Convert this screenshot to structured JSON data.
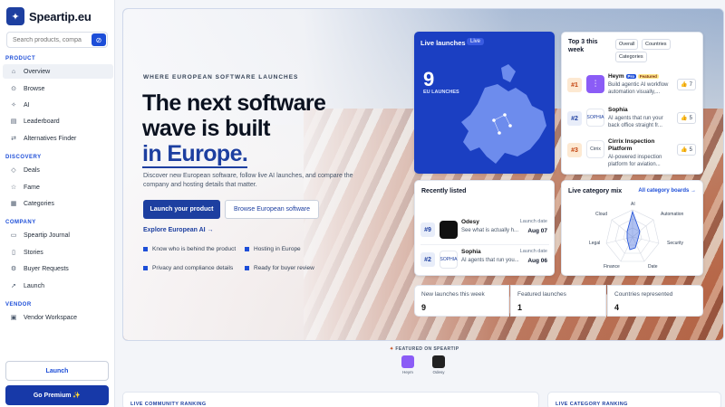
{
  "brand": {
    "name": "Speartip.eu"
  },
  "search": {
    "placeholder": "Search products, compa"
  },
  "sidebar": {
    "product_label": "PRODUCT",
    "product_items": [
      {
        "label": "Overview",
        "icon": "home-icon"
      },
      {
        "label": "Browse",
        "icon": "compass-icon"
      },
      {
        "label": "AI",
        "icon": "sparkle-icon"
      },
      {
        "label": "Leaderboard",
        "icon": "chart-icon"
      },
      {
        "label": "Alternatives Finder",
        "icon": "swap-icon"
      }
    ],
    "discovery_label": "DISCOVERY",
    "discovery_items": [
      {
        "label": "Deals",
        "icon": "tag-icon"
      },
      {
        "label": "Fame",
        "icon": "star-icon"
      },
      {
        "label": "Categories",
        "icon": "grid-icon"
      }
    ],
    "company_label": "COMPANY",
    "company_items": [
      {
        "label": "Speartip Journal",
        "icon": "book-icon"
      },
      {
        "label": "Stories",
        "icon": "doc-icon"
      },
      {
        "label": "Buyer Requests",
        "icon": "cog-icon"
      },
      {
        "label": "Launch",
        "icon": "rocket-icon"
      }
    ],
    "vendor_label": "VENDOR",
    "vendor_items": [
      {
        "label": "Vendor Workspace",
        "icon": "briefcase-icon"
      }
    ],
    "launch_button": "Launch",
    "premium_button": "Go Premium ✨"
  },
  "hero": {
    "kicker": "WHERE EUROPEAN SOFTWARE LAUNCHES",
    "title_line1": "The next software",
    "title_line2": "wave is built",
    "title_line3": "in Europe.",
    "subtitle": "Discover new European software, follow live AI launches, and compare the company and hosting details that matter.",
    "cta_primary": "Launch your product",
    "cta_secondary": "Browse European software",
    "explore_link": "Explore European AI →",
    "bullets": [
      "Know who is behind the product",
      "Hosting in Europe",
      "Privacy and compliance details",
      "Ready for buyer review"
    ]
  },
  "live_launches": {
    "title": "Live launches",
    "badge": "Live",
    "count": "9",
    "label": "EU LAUNCHES"
  },
  "top3": {
    "title": "Top 3 this week",
    "filters": [
      "Overall",
      "Countries",
      "Categories"
    ],
    "items": [
      {
        "rank": "#1",
        "name": "Heym",
        "desc": "Build agentic AI workflow automation visually,...",
        "votes": "7",
        "pro": "Pro",
        "featured": "Featured"
      },
      {
        "rank": "#2",
        "name": "Sophia",
        "desc": "AI agents that run your back office straight fr...",
        "votes": "5",
        "logo_text": "SOPHIA"
      },
      {
        "rank": "#3",
        "name": "Cirrix Inspection Platform",
        "desc": "AI-powered inspection platform for aviation...",
        "votes": "5",
        "logo_text": "Cirrix"
      }
    ]
  },
  "recent": {
    "title": "Recently listed",
    "date_label": "Launch date",
    "items": [
      {
        "rank": "#9",
        "name": "Odesy",
        "desc": "See what is actually h...",
        "date": "Aug 07"
      },
      {
        "rank": "#2",
        "name": "Sophia",
        "desc": "AI agents that run you...",
        "date": "Aug 06",
        "logo_text": "SOPHIA"
      }
    ]
  },
  "category_mix": {
    "title": "Live category mix",
    "link": "All category boards →",
    "axes": [
      "AI",
      "Automation",
      "Security",
      "Date",
      "Finance",
      "Legal",
      "Cloud"
    ]
  },
  "stats": [
    {
      "label": "New launches this week",
      "value": "9"
    },
    {
      "label": "Featured launches",
      "value": "1"
    },
    {
      "label": "Countries represented",
      "value": "4"
    }
  ],
  "featured_strip": {
    "label": "FEATURED ON SPEARTIP",
    "items": [
      "Heym",
      "Odesy"
    ]
  },
  "bottom": {
    "left_title": "LIVE COMMUNITY RANKING",
    "right_title": "LIVE CATEGORY RANKING"
  },
  "colors": {
    "accent": "#1d3fa0",
    "live_card": "#1b3fc2",
    "heym_logo": "#8b5cf6"
  }
}
